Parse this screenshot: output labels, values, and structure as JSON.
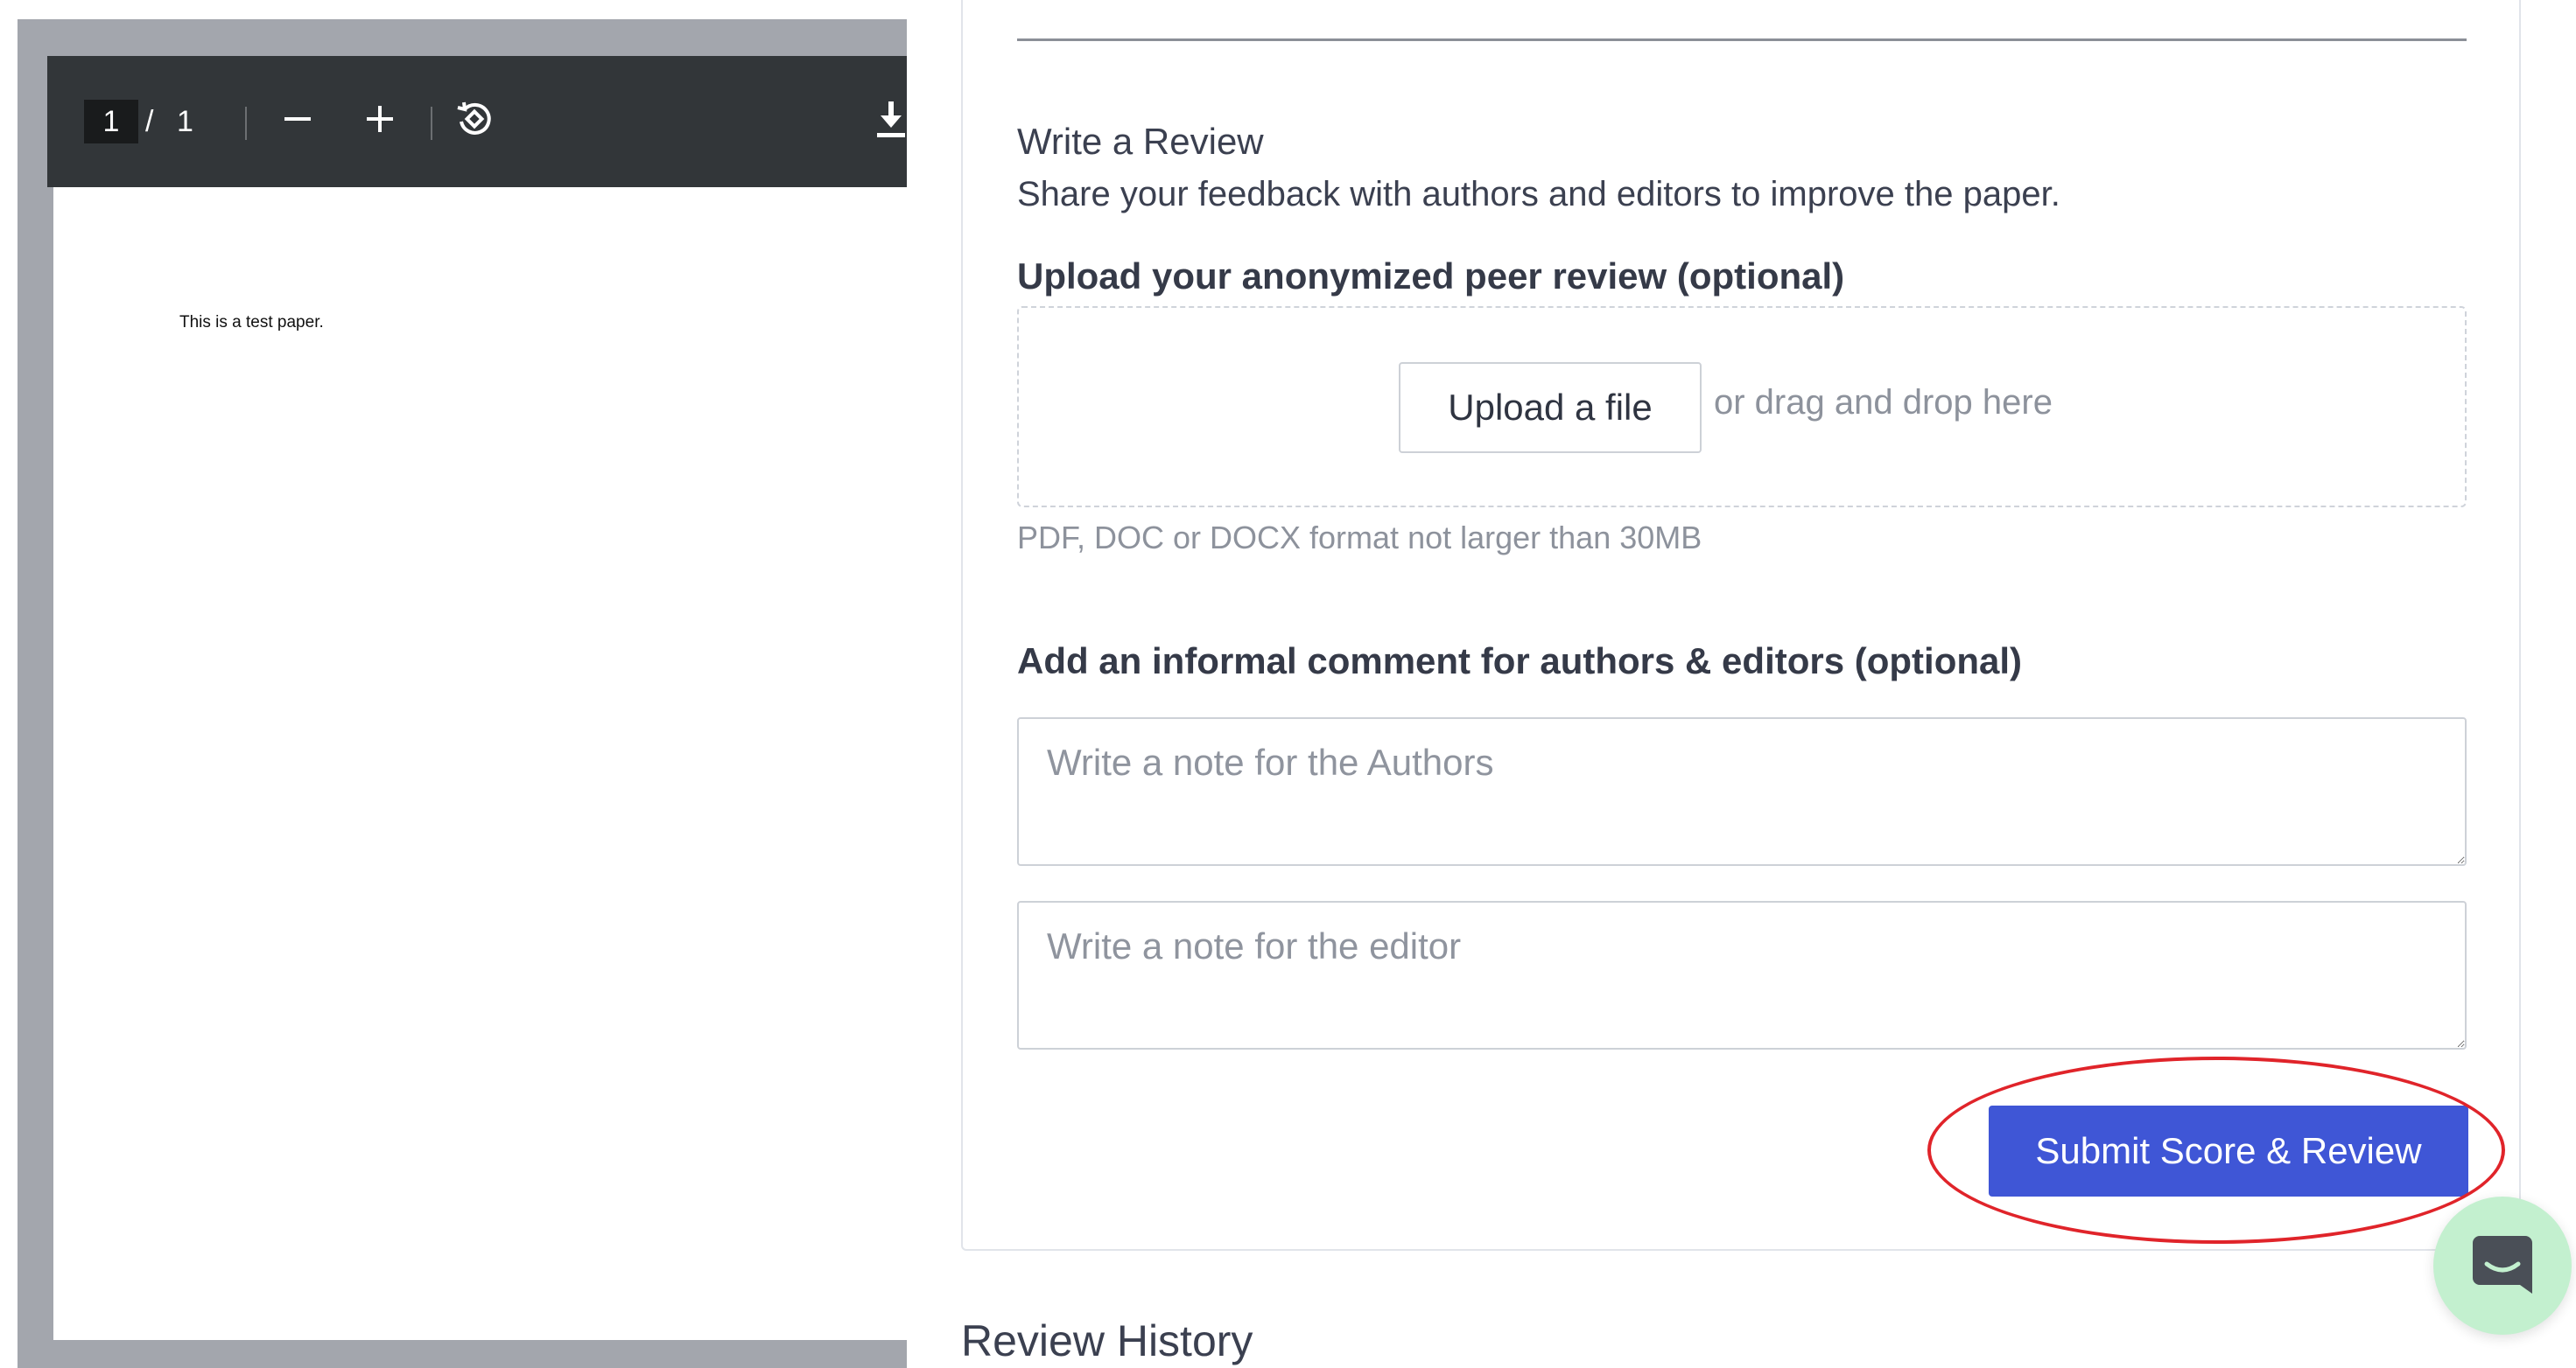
{
  "pdf_viewer": {
    "current_page": "1",
    "page_separator": "/",
    "total_pages": "1",
    "page_text": "This is a test paper.",
    "icons": [
      "zoom-out-icon",
      "zoom-in-icon",
      "rotate-icon",
      "download-icon"
    ]
  },
  "review": {
    "title": "Write a Review",
    "subtitle": "Share your feedback with authors and editors to improve the paper.",
    "upload_label": "Upload your anonymized peer review (optional)",
    "upload_button": "Upload a file",
    "drag_text": "or drag and drop here",
    "format_hint": "PDF, DOC or DOCX format not larger than 30MB",
    "comment_label": "Add an informal comment for authors & editors (optional)",
    "authors_note": {
      "placeholder": "Write a note for the Authors",
      "value": ""
    },
    "editor_note": {
      "placeholder": "Write a note for the editor",
      "value": ""
    },
    "submit_button": "Submit Score & Review",
    "submit_highlight_color": "#e0242a"
  },
  "history": {
    "title": "Review History"
  },
  "chat": {
    "icon": "chat-icon",
    "color": "#c3f0cf"
  },
  "colors": {
    "primary": "#3f56d6",
    "pdf_toolbar": "#323639"
  }
}
